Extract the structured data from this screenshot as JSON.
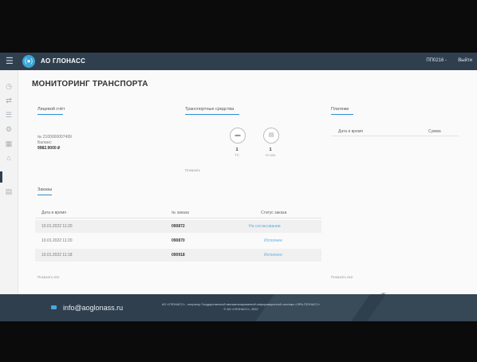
{
  "topbar": {
    "brand": "АО ГЛОНАСС",
    "logo_text": "(●)",
    "account": "ПП0216 -",
    "logout": "Выйти"
  },
  "page": {
    "title": "МОНИТОРИНГ ТРАНСПОРТА"
  },
  "personal_account": {
    "heading": "Лицевой счёт",
    "number": "№ 2100000007499",
    "balance_label": "Баланс:",
    "balance_value": "9982.9000 ₽"
  },
  "vehicles": {
    "heading": "Транспортные средства",
    "items": [
      {
        "count": "1",
        "label": "ТС"
      },
      {
        "count": "1",
        "label": "Н-сим"
      }
    ],
    "more_link": "Показать"
  },
  "payments": {
    "heading": "Платежи",
    "columns": [
      "Дата и время",
      "Сумма"
    ],
    "more_link": "Показать все"
  },
  "orders": {
    "heading": "Заказы",
    "columns": [
      "Дата и время",
      "№ заказа",
      "Статус заказа"
    ],
    "rows": [
      {
        "date": "10.01.2022 11:20",
        "number": "090872",
        "status": "На согласовании"
      },
      {
        "date": "10.01.2022 11:20",
        "number": "090870",
        "status": "Исполнен"
      },
      {
        "date": "10.01.2022 11:18",
        "number": "090918",
        "status": "Исполнен"
      }
    ],
    "more_link": "Показать все"
  },
  "footer": {
    "email": "info@aoglonass.ru",
    "legal_line1": "АО «ГЛОНАСС» - оператор Государственной автоматизированной информационной системы «ЭРА-ГЛОНАСС»",
    "legal_line2": "© АО «ГЛОНАСС», 2022"
  },
  "colors": {
    "topbar": "#2f3f4e",
    "accent": "#2d8fd0",
    "status_link": "#5aaee0"
  }
}
